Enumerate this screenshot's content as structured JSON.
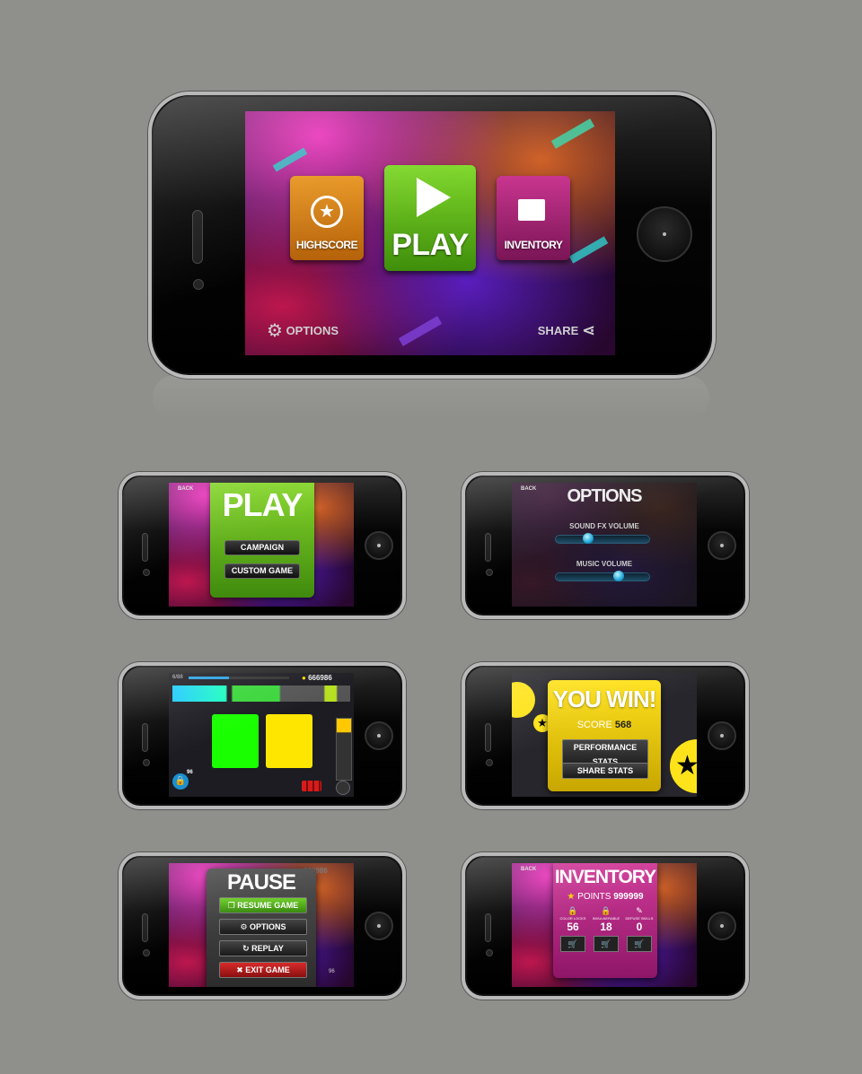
{
  "main_menu": {
    "highscore_label": "HIGHSCORE",
    "play_label": "PLAY",
    "inventory_label": "INVENTORY",
    "options_label": "OPTIONS",
    "share_label": "SHARE"
  },
  "play_menu": {
    "back_label": "BACK",
    "title": "PLAY",
    "campaign_label": "CAMPAIGN",
    "custom_game_label": "CUSTOM GAME"
  },
  "options_menu": {
    "back_label": "BACK",
    "title": "OPTIONS",
    "sound_fx_label": "SOUND FX VOLUME",
    "sound_fx_value": 0.33,
    "music_label": "MUSIC VOLUME",
    "music_value": 0.7
  },
  "gameplay": {
    "level_counter": "6/88",
    "score": "666986",
    "locks_count": "96",
    "tile_colors": [
      "#19ff00",
      "#ffe600"
    ]
  },
  "win_screen": {
    "title": "YOU WIN!",
    "score_label": "SCORE",
    "score_value": "568",
    "performance_stats_label": "PERFORMANCE STATS",
    "share_stats_label": "SHARE STATS"
  },
  "pause_menu": {
    "title": "PAUSE",
    "score": "666986",
    "resume_label": "RESUME GAME",
    "options_label": "OPTIONS",
    "replay_label": "REPLAY",
    "exit_label": "EXIT GAME",
    "locks_count": "96"
  },
  "inventory_screen": {
    "back_label": "BACK",
    "title": "INVENTORY",
    "points_label": "POINTS",
    "points_value": "999999",
    "items": [
      {
        "label": "COLOR LOCKS",
        "value": "56",
        "icon": "lock-icon"
      },
      {
        "label": "INVULNERABLE",
        "value": "18",
        "icon": "lock-icon"
      },
      {
        "label": "DEFUSE SKILLS",
        "value": "0",
        "icon": "tool-icon"
      }
    ]
  }
}
